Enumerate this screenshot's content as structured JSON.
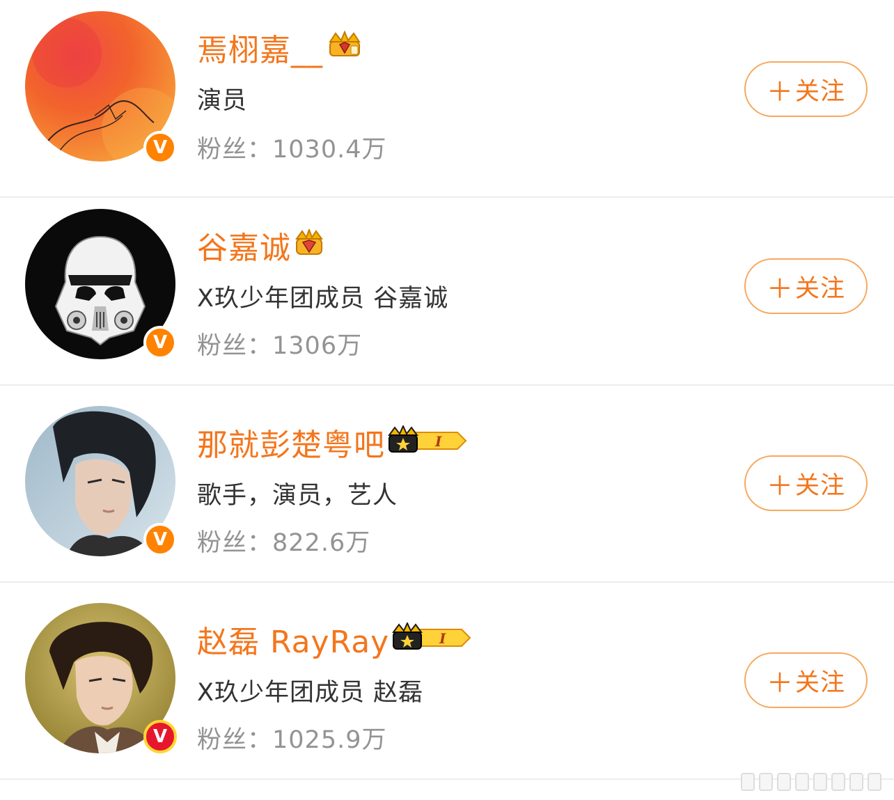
{
  "users": [
    {
      "name": "焉栩嘉__",
      "bio": "演员",
      "fans_label": "粉丝：",
      "fans_count": "1030.4万",
      "follow_label": "关注",
      "follow_plus": "＋",
      "vip_icon": "crown-diamond-icon",
      "verified_icon": "verified-v-icon",
      "avatar_icon": "red-orange-watercolor-signature"
    },
    {
      "name": "谷嘉诚",
      "bio": "X玖少年团成员  谷嘉诚",
      "fans_label": "粉丝：",
      "fans_count": "1306万",
      "follow_label": "关注",
      "follow_plus": "＋",
      "vip_icon": "crown-gem-icon",
      "verified_icon": "verified-v-icon",
      "avatar_icon": "stormtrooper-helmet"
    },
    {
      "name": "那就彭楚粤吧",
      "bio": "歌手，演员，艺人",
      "fans_label": "粉丝：",
      "fans_count": "822.6万",
      "follow_label": "关注",
      "follow_plus": "＋",
      "vip_icon": "crown-level-1-icon",
      "verified_icon": "verified-v-icon",
      "avatar_icon": "portrait-photo"
    },
    {
      "name": "赵磊 RayRay",
      "bio": "X玖少年团成员 赵磊",
      "fans_label": "粉丝：",
      "fans_count": "1025.9万",
      "follow_label": "关注",
      "follow_plus": "＋",
      "vip_icon": "crown-level-1-icon",
      "verified_icon": "verified-v-red-icon",
      "avatar_icon": "portrait-photo"
    }
  ],
  "vip_level_text": "I",
  "verified_letter": "V",
  "colors": {
    "accent": "#f3761c",
    "button_border": "#f7a85c",
    "verified_orange": "#ff8200",
    "verified_red": "#e6162d",
    "fans_gray": "#939393",
    "bio_dark": "#333333",
    "divider": "#ececec"
  }
}
